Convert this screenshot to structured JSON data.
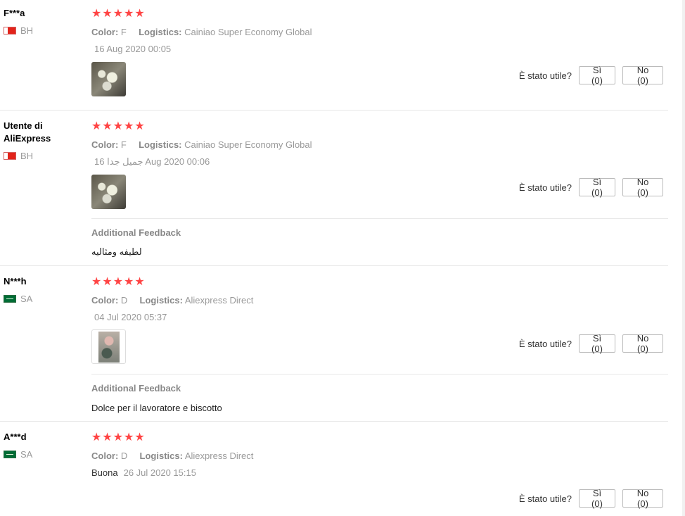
{
  "reviews": [
    {
      "user": "F***a",
      "country": "BH",
      "stars": "★★★★★",
      "color_label": "Color:",
      "color_value": "F",
      "logistics_label": "Logistics:",
      "logistics_value": "Cainiao Super Economy Global",
      "text": "",
      "date": "16 Aug 2020 00:05",
      "helpful_q": "È stato utile?",
      "yes": "Sì (0)",
      "no": "No (0)"
    },
    {
      "user": "Utente di AliExpress",
      "country": "BH",
      "stars": "★★★★★",
      "color_label": "Color:",
      "color_value": "F",
      "logistics_label": "Logistics:",
      "logistics_value": "Cainiao Super Economy Global",
      "text": "جميل جدا",
      "date": "16 Aug 2020 00:06",
      "helpful_q": "È stato utile?",
      "yes": "Sì (0)",
      "no": "No (0)",
      "feedback_title": "Additional Feedback",
      "feedback_text": "لطيفه ومثاليه"
    },
    {
      "user": "N***h",
      "country": "SA",
      "stars": "★★★★★",
      "color_label": "Color:",
      "color_value": "D",
      "logistics_label": "Logistics:",
      "logistics_value": "Aliexpress Direct",
      "text": "",
      "date": "04 Jul 2020 05:37",
      "helpful_q": "È stato utile?",
      "yes": "Sì (0)",
      "no": "No (0)",
      "feedback_title": "Additional Feedback",
      "feedback_text": "Dolce per il lavoratore e biscotto"
    },
    {
      "user": "A***d",
      "country": "SA",
      "stars": "★★★★★",
      "color_label": "Color:",
      "color_value": "D",
      "logistics_label": "Logistics:",
      "logistics_value": "Aliexpress Direct",
      "text": "Buona",
      "date": "26 Jul 2020 15:15",
      "helpful_q": "È stato utile?",
      "yes": "Sì (0)",
      "no": "No (0)"
    }
  ],
  "colors": {
    "star": "#ff4444",
    "divider": "#e8e8e8",
    "muted": "#999999"
  }
}
